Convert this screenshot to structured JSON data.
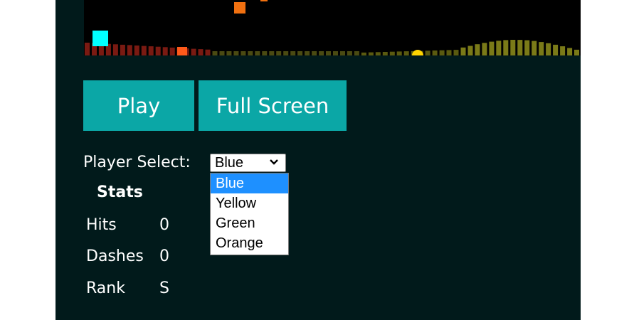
{
  "buttons": {
    "play": "Play",
    "fullscreen": "Full Screen"
  },
  "player_select": {
    "label": "Player Select:",
    "selected": "Blue",
    "options": [
      "Blue",
      "Yellow",
      "Green",
      "Orange"
    ]
  },
  "stats": {
    "title": "Stats",
    "rows": [
      {
        "label": "Hits",
        "value": "0"
      },
      {
        "label": "Dashes",
        "value": "0"
      },
      {
        "label": "Rank",
        "value": "S"
      }
    ]
  },
  "colors": {
    "background": "#011a1b",
    "button": "#0ba7a6",
    "player_blue": "#00ffff",
    "enemy_orange": "#ff6a00",
    "player_yellow": "#ffd400",
    "highlight": "#1e90ff"
  },
  "game": {
    "icons": [
      "cyan-player-square",
      "orange-enemy-square",
      "yellow-orb",
      "audio-visualizer-bars"
    ]
  }
}
